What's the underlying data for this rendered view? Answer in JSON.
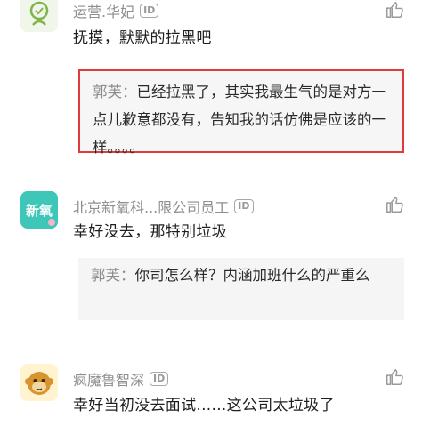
{
  "comments": [
    {
      "author": "运营.华妃",
      "id_badge": "ID",
      "avatar_icon": "green-robot-avatar-icon",
      "text": "抚摸，默默的拉黑吧",
      "reply": {
        "author": "郭芙：",
        "text": "已经拉黑了，其实我最生气的是对方一点儿歉意都没有，告知我的话仿佛是应该的一样。。。。"
      }
    },
    {
      "author": "北京新氧科...限公司员工",
      "id_badge": "ID",
      "avatar_text": "新氧",
      "text": "幸好没去，那特别垃圾",
      "reply": {
        "author": "郭芙：",
        "text": "你司怎么样？内涵加班什么的严重么"
      }
    },
    {
      "author": "疯魔鲁智深",
      "id_badge": "ID",
      "avatar_icon": "monkey-avatar-icon",
      "text": "幸好当初没去面试......这公司太垃圾了"
    }
  ],
  "colors": {
    "highlight_border": "#e03a3a",
    "reply_bg": "#f5f5f5",
    "avatar_teal": "#3ec7b8"
  },
  "icons": {
    "like": "thumbs-up-icon"
  }
}
